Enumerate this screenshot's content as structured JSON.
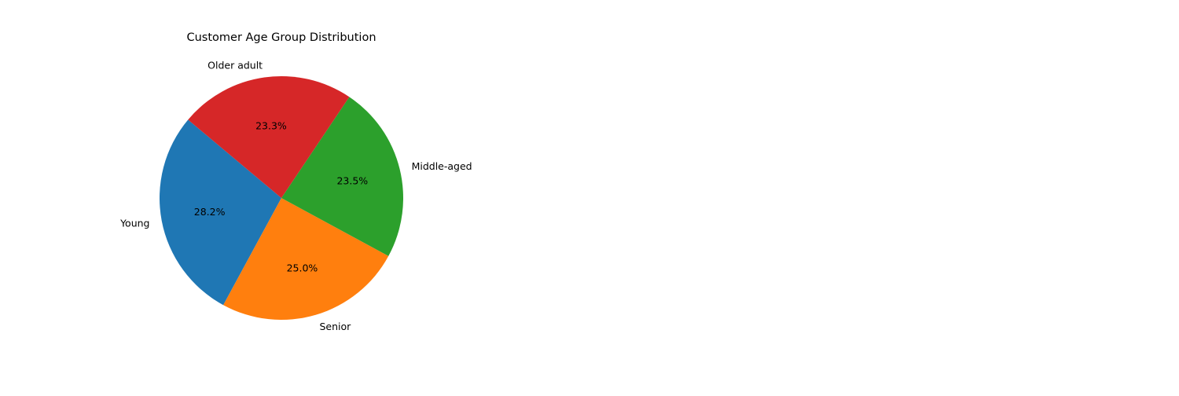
{
  "chart_data": {
    "type": "pie",
    "title": "Customer Age Group Distribution",
    "labels": [
      "Young",
      "Senior",
      "Middle-aged",
      "Older adult"
    ],
    "percent_labels": [
      "28.2%",
      "25.0%",
      "23.5%",
      "23.3%"
    ],
    "values": [
      28.2,
      25.0,
      23.5,
      23.3
    ],
    "colors": [
      "#1f77b4",
      "#ff7f0e",
      "#2ca02c",
      "#d62728"
    ],
    "start_angle_deg": 140,
    "direction": "counterclockwise"
  }
}
